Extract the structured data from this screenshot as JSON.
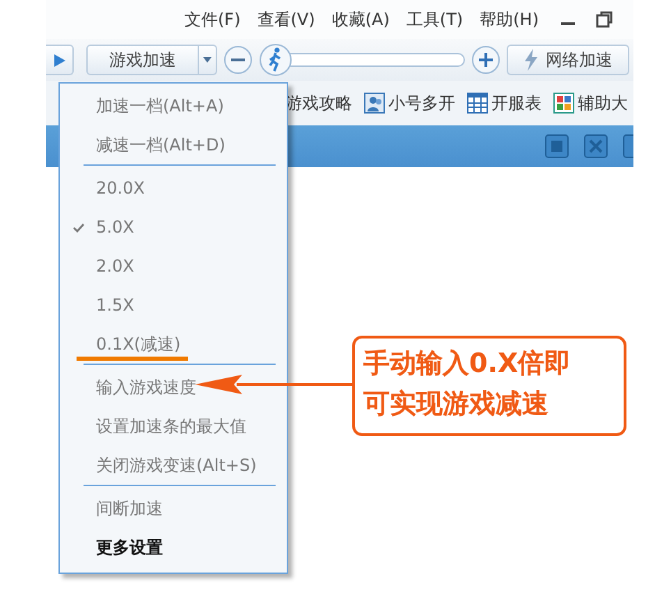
{
  "menu_bar": {
    "items": [
      "文件(F)",
      "查看(V)",
      "收藏(A)",
      "工具(T)",
      "帮助(H)"
    ]
  },
  "toolbar": {
    "mode": "游戏加速",
    "speed_slider": {
      "level": 0
    },
    "network_button": "网络加速"
  },
  "links": [
    {
      "label": "游戏攻略"
    },
    {
      "label": "小号多开"
    },
    {
      "label": "开服表"
    },
    {
      "label": "辅助大"
    }
  ],
  "dropdown_menu": {
    "items": [
      {
        "kind": "item",
        "label": "加速一档(Alt+A)",
        "checked": false,
        "bold": false,
        "underlined": false
      },
      {
        "kind": "item",
        "label": "减速一档(Alt+D)",
        "checked": false,
        "bold": false,
        "underlined": false
      },
      {
        "kind": "separator"
      },
      {
        "kind": "item",
        "label": "20.0X",
        "checked": false,
        "bold": false,
        "underlined": false
      },
      {
        "kind": "item",
        "label": "5.0X",
        "checked": true,
        "bold": false,
        "underlined": false
      },
      {
        "kind": "item",
        "label": "2.0X",
        "checked": false,
        "bold": false,
        "underlined": false
      },
      {
        "kind": "item",
        "label": "1.5X",
        "checked": false,
        "bold": false,
        "underlined": false
      },
      {
        "kind": "item",
        "label": "0.1X(减速)",
        "checked": false,
        "bold": false,
        "underlined": true
      },
      {
        "kind": "separator"
      },
      {
        "kind": "item",
        "label": "输入游戏速度",
        "checked": false,
        "bold": false,
        "underlined": false
      },
      {
        "kind": "item",
        "label": "设置加速条的最大值",
        "checked": false,
        "bold": false,
        "underlined": false
      },
      {
        "kind": "item",
        "label": "关闭游戏变速(Alt+S)",
        "checked": false,
        "bold": false,
        "underlined": false
      },
      {
        "kind": "separator"
      },
      {
        "kind": "item",
        "label": "间断加速",
        "checked": false,
        "bold": false,
        "underlined": false
      },
      {
        "kind": "item",
        "label": "更多设置",
        "checked": false,
        "bold": true,
        "underlined": false
      }
    ]
  },
  "annotation": {
    "lines": [
      "手动输入0.X倍即",
      "可实现游戏减速"
    ]
  }
}
